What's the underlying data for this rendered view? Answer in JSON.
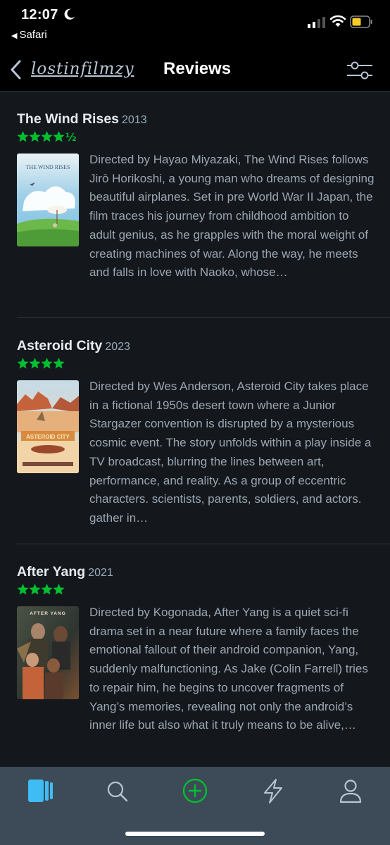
{
  "status_bar": {
    "time": "12:07",
    "back_app": "Safari",
    "icons": [
      "moon-icon",
      "signal-icon",
      "wifi-icon",
      "battery-icon"
    ]
  },
  "header": {
    "username": "lostinfilmzy",
    "title": "Reviews",
    "icons": [
      "back-chevron-icon",
      "filter-sliders-icon"
    ]
  },
  "colors": {
    "star_green": "#00c030",
    "background": "#14181c",
    "tabbar": "#3d4a57",
    "active_tab": "#40bcf4",
    "add_green": "#00c030"
  },
  "reviews": [
    {
      "title": "The Wind Rises",
      "year": "2013",
      "rating": 4.5,
      "stars_text": "★★★★½",
      "poster_text": "THE WIND RISES",
      "body": "Directed by Hayao Miyazaki, The Wind Rises follows Jirō Horikoshi, a young man who dreams of designing beautiful airplanes. Set in pre World War II Japan, the film traces his journey from childhood ambition to adult genius, as he grapples with the moral weight of creating machines of war. Along the way, he meets and falls in love with Naoko, whose…"
    },
    {
      "title": "Asteroid City",
      "year": "2023",
      "rating": 4,
      "stars_text": "★★★★",
      "poster_text": "ASTEROID CITY",
      "body": "Directed by Wes Anderson, Asteroid City takes place in a fictional 1950s desert town where a Junior Stargazer convention is disrupted by a mysterious cosmic event. The story unfolds within a play inside a TV broadcast, blurring the lines between art, performance, and reality. As a group of eccentric characters. scientists, parents, soldiers, and actors. gather in…"
    },
    {
      "title": "After Yang",
      "year": "2021",
      "rating": 4,
      "stars_text": "★★★★",
      "poster_text": "AFTER YANG",
      "body": "Directed by Kogonada, After Yang is a quiet sci-fi drama set in a near future where a family faces the emotional fallout of their android companion, Yang, suddenly malfunctioning. As Jake (Colin Farrell) tries to repair him, he begins to uncover fragments of Yang’s memories, revealing not only the android’s inner life but also what it truly means to be alive,…"
    }
  ],
  "tabbar": {
    "tabs": [
      {
        "icon": "films-icon",
        "active": true
      },
      {
        "icon": "search-icon",
        "active": false
      },
      {
        "icon": "add-icon",
        "active": false
      },
      {
        "icon": "activity-icon",
        "active": false
      },
      {
        "icon": "profile-icon",
        "active": false
      }
    ]
  }
}
